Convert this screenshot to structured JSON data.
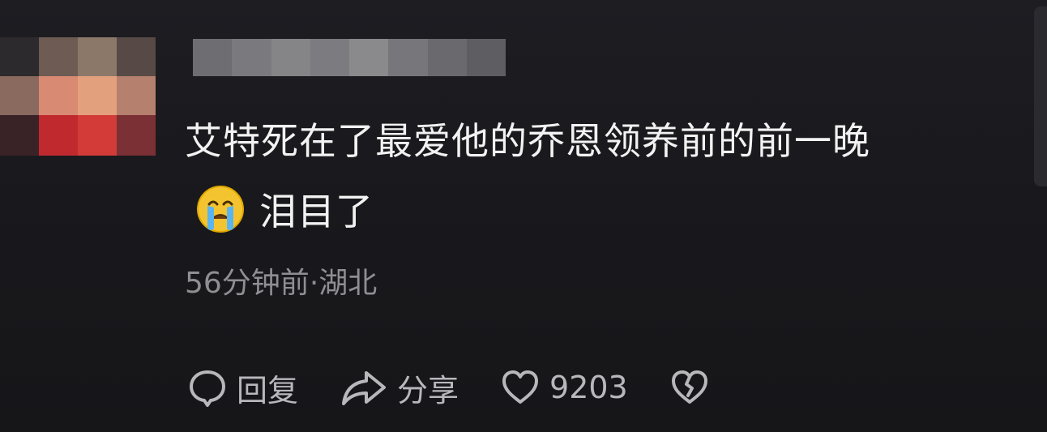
{
  "comment": {
    "text_line1": "艾特死在了最爱他的乔恩领养前的前一晚",
    "emoji": "crying-face-icon",
    "text_line2": "泪目了",
    "time_ago": "56分钟前",
    "separator": "·",
    "location": "湖北"
  },
  "actions": {
    "reply_label": "回复",
    "share_label": "分享",
    "like_count": "9203"
  },
  "colors": {
    "background": "#1b1b1f",
    "text_primary": "#f2f2f2",
    "text_secondary": "#8e8e93",
    "icon": "#b8b8bc"
  }
}
